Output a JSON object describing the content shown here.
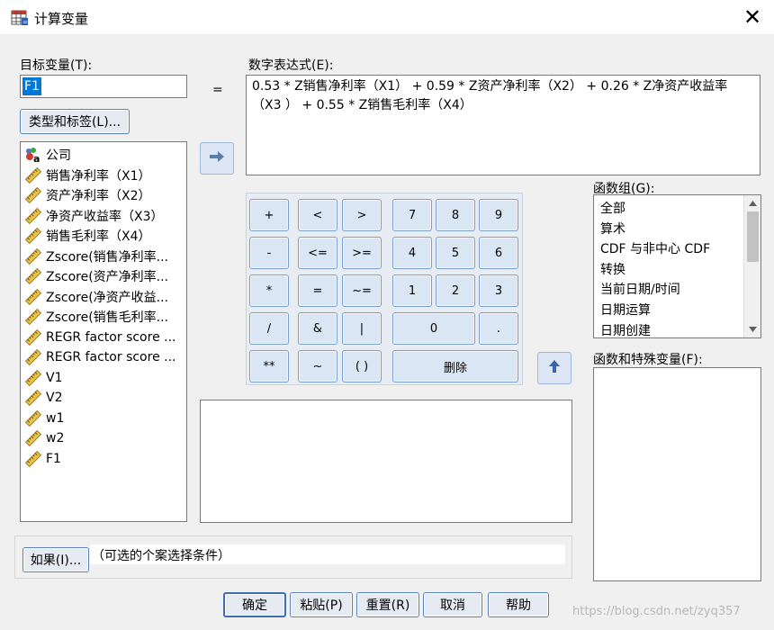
{
  "window": {
    "title": "计算变量"
  },
  "target": {
    "label": "目标变量(T):",
    "value": "F1"
  },
  "type_label_button": "类型和标签(L)...",
  "equals": "=",
  "expression": {
    "label": "数字表达式(E):",
    "value": "0.53 * Z销售净利率（X1） + 0.59 * Z资产净利率（X2） + 0.26 * Z净资产收益率（X3 ） + 0.55 * Z销售毛利率（X4）"
  },
  "variables": [
    {
      "name": "公司",
      "icon": "nominal-string-icon"
    },
    {
      "name": "销售净利率（X1）",
      "icon": "scale-ruler-icon"
    },
    {
      "name": "资产净利率（X2）",
      "icon": "scale-ruler-icon"
    },
    {
      "name": "净资产收益率（X3）",
      "icon": "scale-ruler-icon"
    },
    {
      "name": "销售毛利率（X4）",
      "icon": "scale-ruler-icon"
    },
    {
      "name": "Zscore(销售净利率...",
      "icon": "scale-ruler-icon"
    },
    {
      "name": "Zscore(资产净利率...",
      "icon": "scale-ruler-icon"
    },
    {
      "name": "Zscore(净资产收益...",
      "icon": "scale-ruler-icon"
    },
    {
      "name": "Zscore(销售毛利率...",
      "icon": "scale-ruler-icon"
    },
    {
      "name": "REGR factor score ...",
      "icon": "scale-ruler-icon"
    },
    {
      "name": "REGR factor score ...",
      "icon": "scale-ruler-icon"
    },
    {
      "name": "V1",
      "icon": "scale-ruler-icon"
    },
    {
      "name": "V2",
      "icon": "scale-ruler-icon"
    },
    {
      "name": "w1",
      "icon": "scale-ruler-icon"
    },
    {
      "name": "w2",
      "icon": "scale-ruler-icon"
    },
    {
      "name": "F1",
      "icon": "scale-ruler-icon"
    }
  ],
  "keypad": {
    "ops": [
      "+",
      "<",
      ">",
      "-",
      "<=",
      ">=",
      "*",
      "=",
      "~=",
      "/",
      "&",
      "|",
      "**",
      "~",
      "( )"
    ],
    "digits": [
      "7",
      "8",
      "9",
      "4",
      "5",
      "6",
      "1",
      "2",
      "3",
      "0",
      "."
    ],
    "delete": "删除"
  },
  "function_group": {
    "label": "函数组(G):",
    "items": [
      "全部",
      "算术",
      "CDF 与非中心 CDF",
      "转换",
      "当前日期/时间",
      "日期运算",
      "日期创建"
    ]
  },
  "functions": {
    "label": "函数和特殊变量(F):"
  },
  "if_button": "如果(I)...",
  "if_text": "（可选的个案选择条件）",
  "buttons": {
    "ok": "确定",
    "paste": "粘贴(P)",
    "reset": "重置(R)",
    "cancel": "取消",
    "help": "帮助"
  },
  "watermark": "https://blog.csdn.net/zyq357",
  "colors": {
    "accent": "#5a82b8",
    "selection": "#0078d7",
    "button_face": "#dbe6f4"
  }
}
